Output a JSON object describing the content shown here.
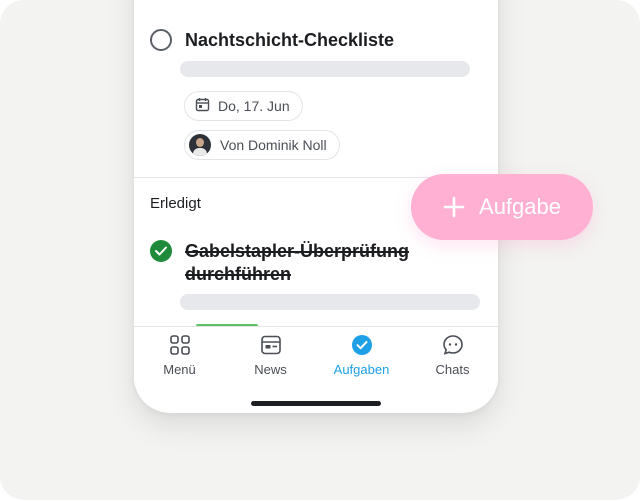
{
  "open_task": {
    "title": "Nachtschicht-Checkliste",
    "due_date": "Do, 17. Jun",
    "author": "Von Dominik Noll"
  },
  "done_section": {
    "label": "Erledigt",
    "task_title": "Gabelstapler-Überprüfung durchführen"
  },
  "fab": {
    "icon": "plus-icon",
    "label": "Aufgabe",
    "color": "#ffb0d3"
  },
  "tabbar": {
    "tabs": [
      {
        "label": "Menü",
        "icon": "grid-icon"
      },
      {
        "label": "News",
        "icon": "news-icon"
      },
      {
        "label": "Aufgaben",
        "icon": "check-circle-icon",
        "active": true
      },
      {
        "label": "Chats",
        "icon": "chat-icon"
      }
    ],
    "active_color": "#1ea0e6"
  }
}
